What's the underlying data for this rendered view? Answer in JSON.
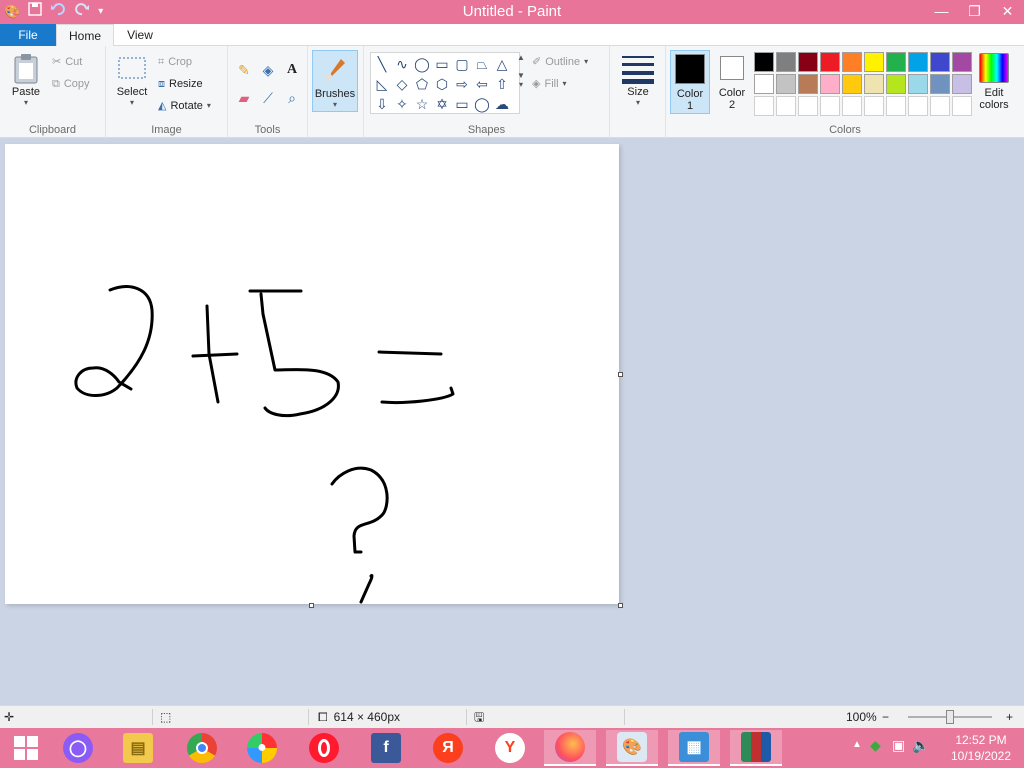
{
  "window": {
    "title": "Untitled - Paint",
    "minimize": "—",
    "restore": "❐",
    "close": "✕"
  },
  "quick_access": {
    "save_icon": "save-icon",
    "undo_icon": "undo-icon",
    "redo_icon": "redo-icon",
    "customize_icon": "chevron-down-icon"
  },
  "tabs": [
    {
      "label": "File"
    },
    {
      "label": "Home"
    },
    {
      "label": "View"
    }
  ],
  "ribbon": {
    "clipboard": {
      "label": "Clipboard",
      "paste": "Paste",
      "cut": "Cut",
      "copy": "Copy"
    },
    "image": {
      "label": "Image",
      "select": "Select",
      "crop": "Crop",
      "resize": "Resize",
      "rotate": "Rotate"
    },
    "tools": {
      "label": "Tools"
    },
    "brushes": {
      "label": "Brushes"
    },
    "shapes": {
      "label": "Shapes",
      "outline": "Outline",
      "fill": "Fill"
    },
    "size": {
      "label": "Size"
    },
    "colors": {
      "label": "Colors",
      "color1_line1": "Color",
      "color1_line2": "1",
      "color2_line1": "Color",
      "color2_line2": "2",
      "edit_line1": "Edit",
      "edit_line2": "colors",
      "color1_value": "#000000",
      "color2_value": "#ffffff",
      "palette_row1": [
        "#000000",
        "#7f7f7f",
        "#880015",
        "#ed1c24",
        "#ff7f27",
        "#fff200",
        "#22b14c",
        "#00a2e8",
        "#3f48cc",
        "#a349a4"
      ],
      "palette_row2": [
        "#ffffff",
        "#c3c3c3",
        "#b97a57",
        "#ffaec9",
        "#ffc90e",
        "#efe4b0",
        "#b5e61d",
        "#99d9ea",
        "#7092be",
        "#c8bfe7"
      ],
      "palette_row3": [
        "#ffffff",
        "#ffffff",
        "#ffffff",
        "#ffffff",
        "#ffffff",
        "#ffffff",
        "#ffffff",
        "#ffffff",
        "#ffffff",
        "#ffffff"
      ]
    }
  },
  "statusbar": {
    "canvas_size": "614 × 460px",
    "zoom": "100%",
    "zoom_out": "−",
    "zoom_in": "+"
  },
  "taskbar": {
    "time": "12:52 PM",
    "date": "10/19/2022"
  }
}
